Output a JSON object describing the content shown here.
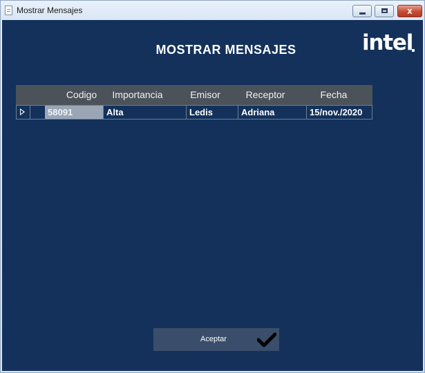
{
  "window": {
    "title": "Mostrar Mensajes",
    "close_glyph": "x"
  },
  "form": {
    "heading": "MOSTRAR MENSAJES",
    "logo_text": "intel",
    "background_color": "#13315b"
  },
  "grid": {
    "columns": [
      "Codigo",
      "Importancia",
      "Emisor",
      "Receptor",
      "Fecha"
    ],
    "rows": [
      {
        "codigo": "58091",
        "importancia": "Alta",
        "emisor": "Ledis",
        "receptor": "Adriana",
        "fecha": "15/nov./2020"
      }
    ],
    "selected_row_indicator": "triangle-right-icon"
  },
  "actions": {
    "accept_label": "Aceptar",
    "accept_icon": "checkmark-icon"
  }
}
